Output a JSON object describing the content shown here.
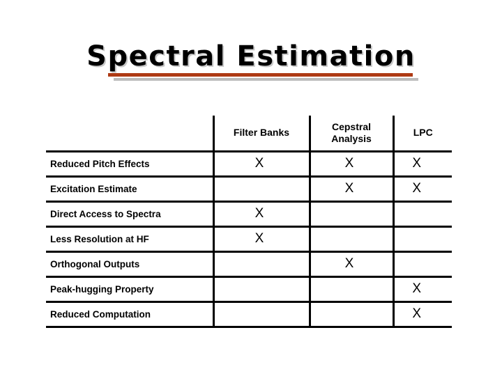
{
  "slide": {
    "title": "Spectral Estimation",
    "accent_color": "#ae3a14",
    "rule_shadow_color": "#bcbcbc",
    "title_shadow_color": "#c8c8c8",
    "background_color": "#ffffff",
    "text_color": "#000000"
  },
  "table": {
    "row_header_label": "",
    "columns": [
      {
        "label": "Filter Banks"
      },
      {
        "label": "Cepstral\nAnalysis",
        "line1": "Cepstral",
        "line2": "Analysis"
      },
      {
        "label": "LPC"
      }
    ],
    "mark_symbol": "X",
    "rows": [
      {
        "label": "Reduced Pitch Effects",
        "marks": [
          "X",
          "X",
          "X"
        ]
      },
      {
        "label": "Excitation Estimate",
        "marks": [
          "",
          "X",
          "X"
        ]
      },
      {
        "label": "Direct Access to Spectra",
        "marks": [
          "X",
          "",
          ""
        ]
      },
      {
        "label": "Less Resolution at HF",
        "marks": [
          "X",
          "",
          ""
        ]
      },
      {
        "label": "Orthogonal Outputs",
        "marks": [
          "",
          "X",
          ""
        ]
      },
      {
        "label": "Peak-hugging Property",
        "marks": [
          "",
          "",
          "X"
        ]
      },
      {
        "label": "Reduced Computation",
        "marks": [
          "",
          "",
          "X"
        ]
      }
    ]
  }
}
